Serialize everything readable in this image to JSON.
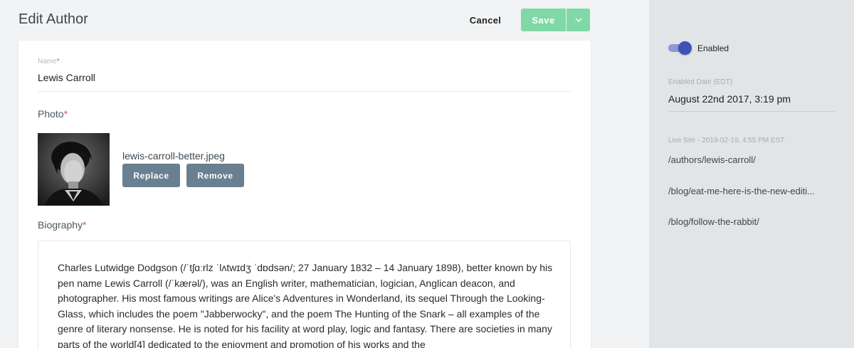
{
  "header": {
    "title": "Edit Author",
    "cancel_label": "Cancel",
    "save_label": "Save",
    "save_menu_icon": "chevron-down-icon"
  },
  "form": {
    "name": {
      "label": "Name",
      "required_marker": "*",
      "value": "Lewis Carroll"
    },
    "photo": {
      "label": "Photo",
      "required_marker": "*",
      "file_name": "lewis-carroll-better.jpeg",
      "replace_label": "Replace",
      "remove_label": "Remove"
    },
    "biography": {
      "label": "Biography",
      "required_marker": "*",
      "text": "Charles Lutwidge Dodgson (/ˈtʃɑːrlz ˈlʌtwɪdʒ ˈdɒdsən/; 27 January 1832 – 14 January 1898), better known by his pen name Lewis Carroll (/ˈkærəl/), was an English writer, mathematician, logician, Anglican deacon, and photographer. His most famous writings are Alice's Adventures in Wonderland, its sequel Through the Looking-Glass, which includes the poem \"Jabberwocky\", and the poem The Hunting of the Snark – all examples of the genre of literary nonsense. He is noted for his facility at word play, logic and fantasy. There are societies in many parts of the world[4] dedicated to the enjoyment and promotion of his works and the"
    }
  },
  "sidebar": {
    "enabled_label": "Enabled",
    "enabled": true,
    "enabled_date_label": "Enabled Date (EDT)",
    "enabled_date_value": "August 22nd 2017, 3:19 pm",
    "live_site_label": "Live Site - 2019-02-19, 4:55 PM EST",
    "live_links": [
      "/authors/lewis-carroll/",
      "/blog/eat-me-here-is-the-new-editi...",
      "/blog/follow-the-rabbit/"
    ]
  },
  "colors": {
    "save_button": "#7fd8a6",
    "secondary_button": "#68808f",
    "toggle_knob": "#3f51b5",
    "required": "#e0524c"
  }
}
